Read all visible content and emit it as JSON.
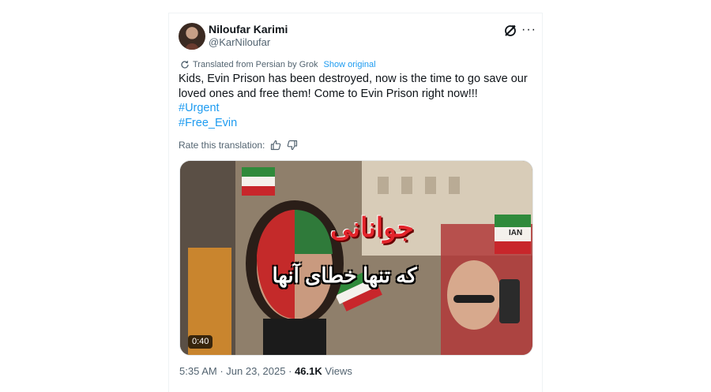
{
  "author": {
    "name": "Niloufar Karimi",
    "handle": "@KarNiloufar"
  },
  "icons": {
    "grok": "grok-icon",
    "more": "more-icon",
    "translate": "translate-icon",
    "thumbs_up": "thumbs-up-icon",
    "thumbs_down": "thumbs-down-icon"
  },
  "translation": {
    "label": "Translated from Persian by Grok",
    "show_original": "Show original"
  },
  "tweet": {
    "text": "Kids, Evin Prison has been destroyed, now is the time to go save our loved ones and free them! Come to Evin Prison right now!!!",
    "hashtags": [
      "#Urgent",
      "#Free_Evin"
    ]
  },
  "rate": {
    "label": "Rate this translation:"
  },
  "media": {
    "overlay_line1": "جوانانی",
    "overlay_line2": "که تنها خطای آنها",
    "flag_text": "IAN",
    "duration": "0:40"
  },
  "meta": {
    "time": "5:35 AM",
    "date": "Jun 23, 2025",
    "views_count": "46.1K",
    "views_label": "Views",
    "separator": "·"
  },
  "colors": {
    "accent": "#1d9bf0",
    "text": "#0f1419",
    "secondary": "#536471"
  }
}
